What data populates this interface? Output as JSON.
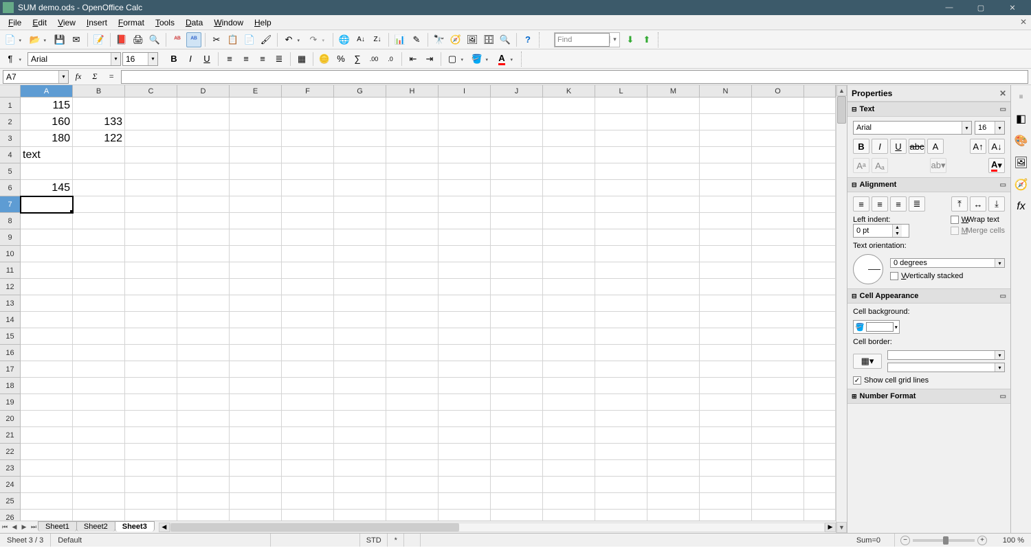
{
  "window": {
    "title": "SUM demo.ods - OpenOffice Calc"
  },
  "menu": [
    "File",
    "Edit",
    "View",
    "Insert",
    "Format",
    "Tools",
    "Data",
    "Window",
    "Help"
  ],
  "find_placeholder": "Find",
  "font": {
    "name": "Arial",
    "size": "16"
  },
  "namebox": "A7",
  "formula": "",
  "columns": [
    "A",
    "B",
    "C",
    "D",
    "E",
    "F",
    "G",
    "H",
    "I",
    "J",
    "K",
    "L",
    "M",
    "N",
    "O"
  ],
  "row_count": 26,
  "selected": {
    "col": "A",
    "row": 7
  },
  "cells": {
    "A1": "115",
    "A2": "160",
    "B2": "133",
    "A3": "180",
    "B3": "122",
    "A4": "text",
    "A6": "145"
  },
  "text_cells": [
    "A4"
  ],
  "sheets": {
    "list": [
      "Sheet1",
      "Sheet2",
      "Sheet3"
    ],
    "active": "Sheet3"
  },
  "properties": {
    "title": "Properties",
    "text": {
      "title": "Text",
      "font": "Arial",
      "size": "16"
    },
    "alignment": {
      "title": "Alignment",
      "left_indent_label": "Left indent:",
      "left_indent": "0 pt",
      "wrap_label": "Wrap text",
      "wrap": false,
      "merge_label": "Merge cells",
      "merge": false,
      "orient_label": "Text orientation:",
      "degrees": "0 degrees",
      "vstack_label": "Vertically stacked",
      "vstack": false
    },
    "appearance": {
      "title": "Cell Appearance",
      "bg_label": "Cell background:",
      "border_label": "Cell border:",
      "gridlines_label": "Show cell grid lines",
      "gridlines": true
    },
    "number": {
      "title": "Number Format"
    }
  },
  "status": {
    "sheet": "Sheet 3 / 3",
    "style": "Default",
    "mode": "STD",
    "insert": "*",
    "sum": "Sum=0",
    "zoom": "100 %"
  }
}
